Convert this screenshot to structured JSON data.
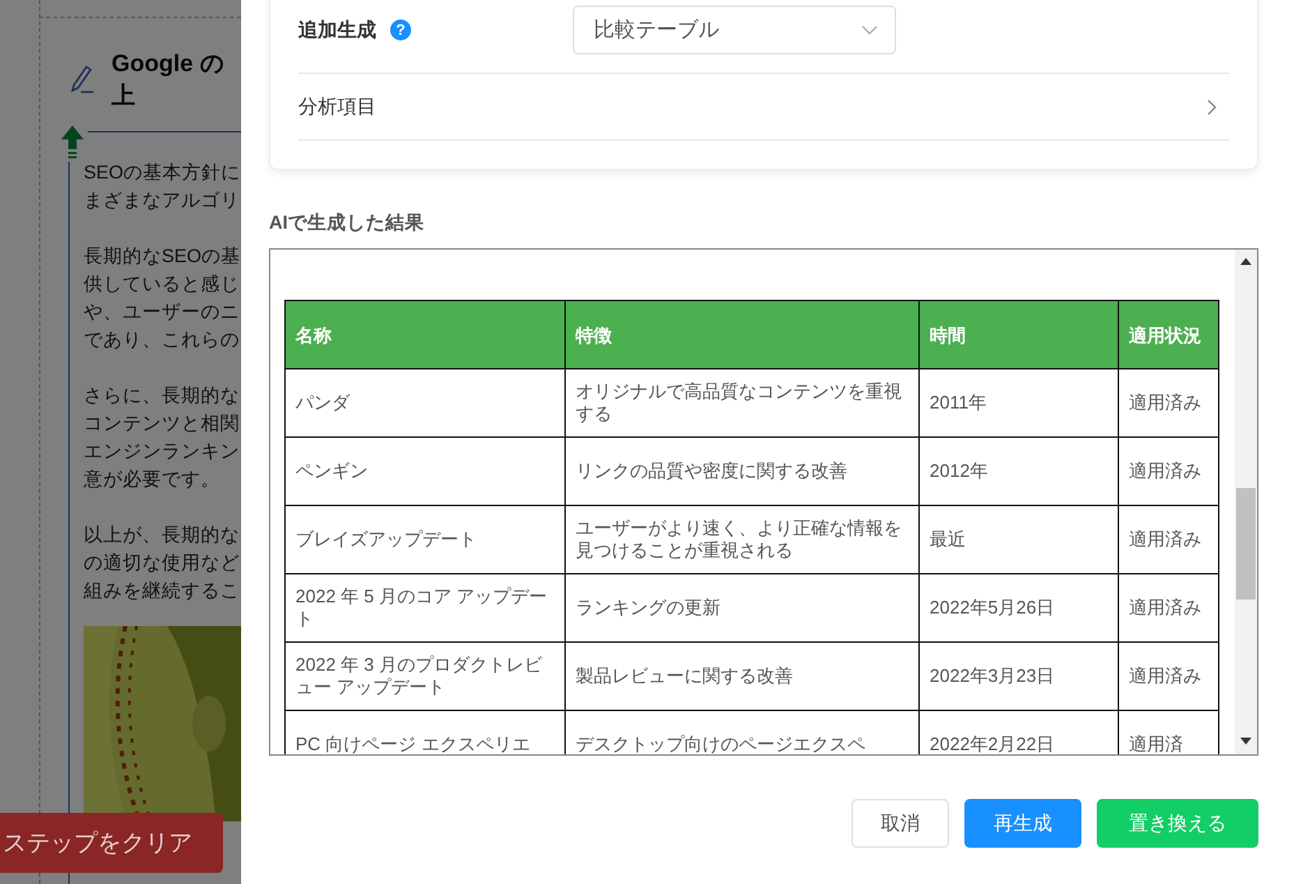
{
  "background_page": {
    "heading_lines": [
      "Google の",
      "上"
    ],
    "paragraphs": [
      [
        "SEOの基本方針に",
        "まざまなアルゴリ"
      ],
      [
        "長期的なSEOの基",
        "供していると感じ",
        "や、ユーザーのニ",
        "であり、これらの"
      ],
      [
        "さらに、長期的な",
        "コンテンツと相関",
        "エンジンランキン",
        "意が必要です。"
      ],
      [
        "以上が、長期的な",
        "の適切な使用など",
        "組みを継続するこ"
      ]
    ],
    "picture": {
      "kind": "picture"
    },
    "clear_button": "ステップをクリア"
  },
  "settings_card": {
    "extra_label": "追加生成",
    "help": "?",
    "extra_select": "比較テーブル",
    "analysis_label": "分析項目"
  },
  "result_label": "AIで生成した結果",
  "table": {
    "columns": [
      "名称",
      "特徴",
      "時間",
      "適用状況"
    ],
    "rows": [
      [
        "パンダ",
        "オリジナルで高品質なコンテンツを重視する",
        "2011年",
        "適用済み"
      ],
      [
        "ペンギン",
        "リンクの品質や密度に関する改善",
        "2012年",
        "適用済み"
      ],
      [
        "ブレイズアップデート",
        "ユーザーがより速く、より正確な情報を見つけることが重視される",
        "最近",
        "適用済み"
      ],
      [
        "2022 年 5 月のコア アップデート",
        "ランキングの更新",
        "2022年5月26日",
        "適用済み"
      ],
      [
        "2022 年 3 月のプロダクトレビュー アップデート",
        "製品レビューに関する改善",
        "2022年3月23日",
        "適用済み"
      ],
      [
        "PC 向けページ エクスペリエ",
        "デスクトップ向けのページエクスペ",
        "2022年2月22日",
        "適用済"
      ]
    ]
  },
  "buttons": [
    {
      "kind": "default",
      "label": "取消"
    },
    {
      "kind": "primary",
      "label": "再生成"
    },
    {
      "kind": "success",
      "label": "置き換える"
    }
  ]
}
